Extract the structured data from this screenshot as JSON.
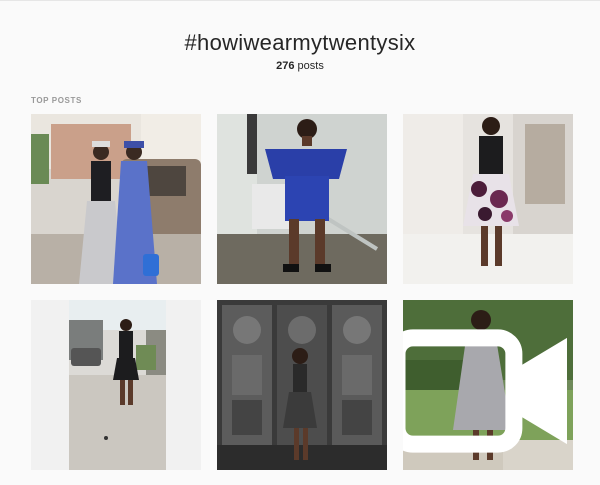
{
  "page": {
    "hashtag": "#howiwearmytwentysix",
    "post_count_number": "276",
    "post_count_suffix": " posts",
    "section_label": "TOP POSTS"
  },
  "posts": [
    {
      "name": "post-1"
    },
    {
      "name": "post-2"
    },
    {
      "name": "post-3"
    },
    {
      "name": "post-4"
    },
    {
      "name": "post-5"
    },
    {
      "name": "post-6",
      "badge": "video-camera-icon"
    }
  ],
  "colors": {
    "background": "#fafafa",
    "text": "#262626",
    "muted": "#999999"
  }
}
